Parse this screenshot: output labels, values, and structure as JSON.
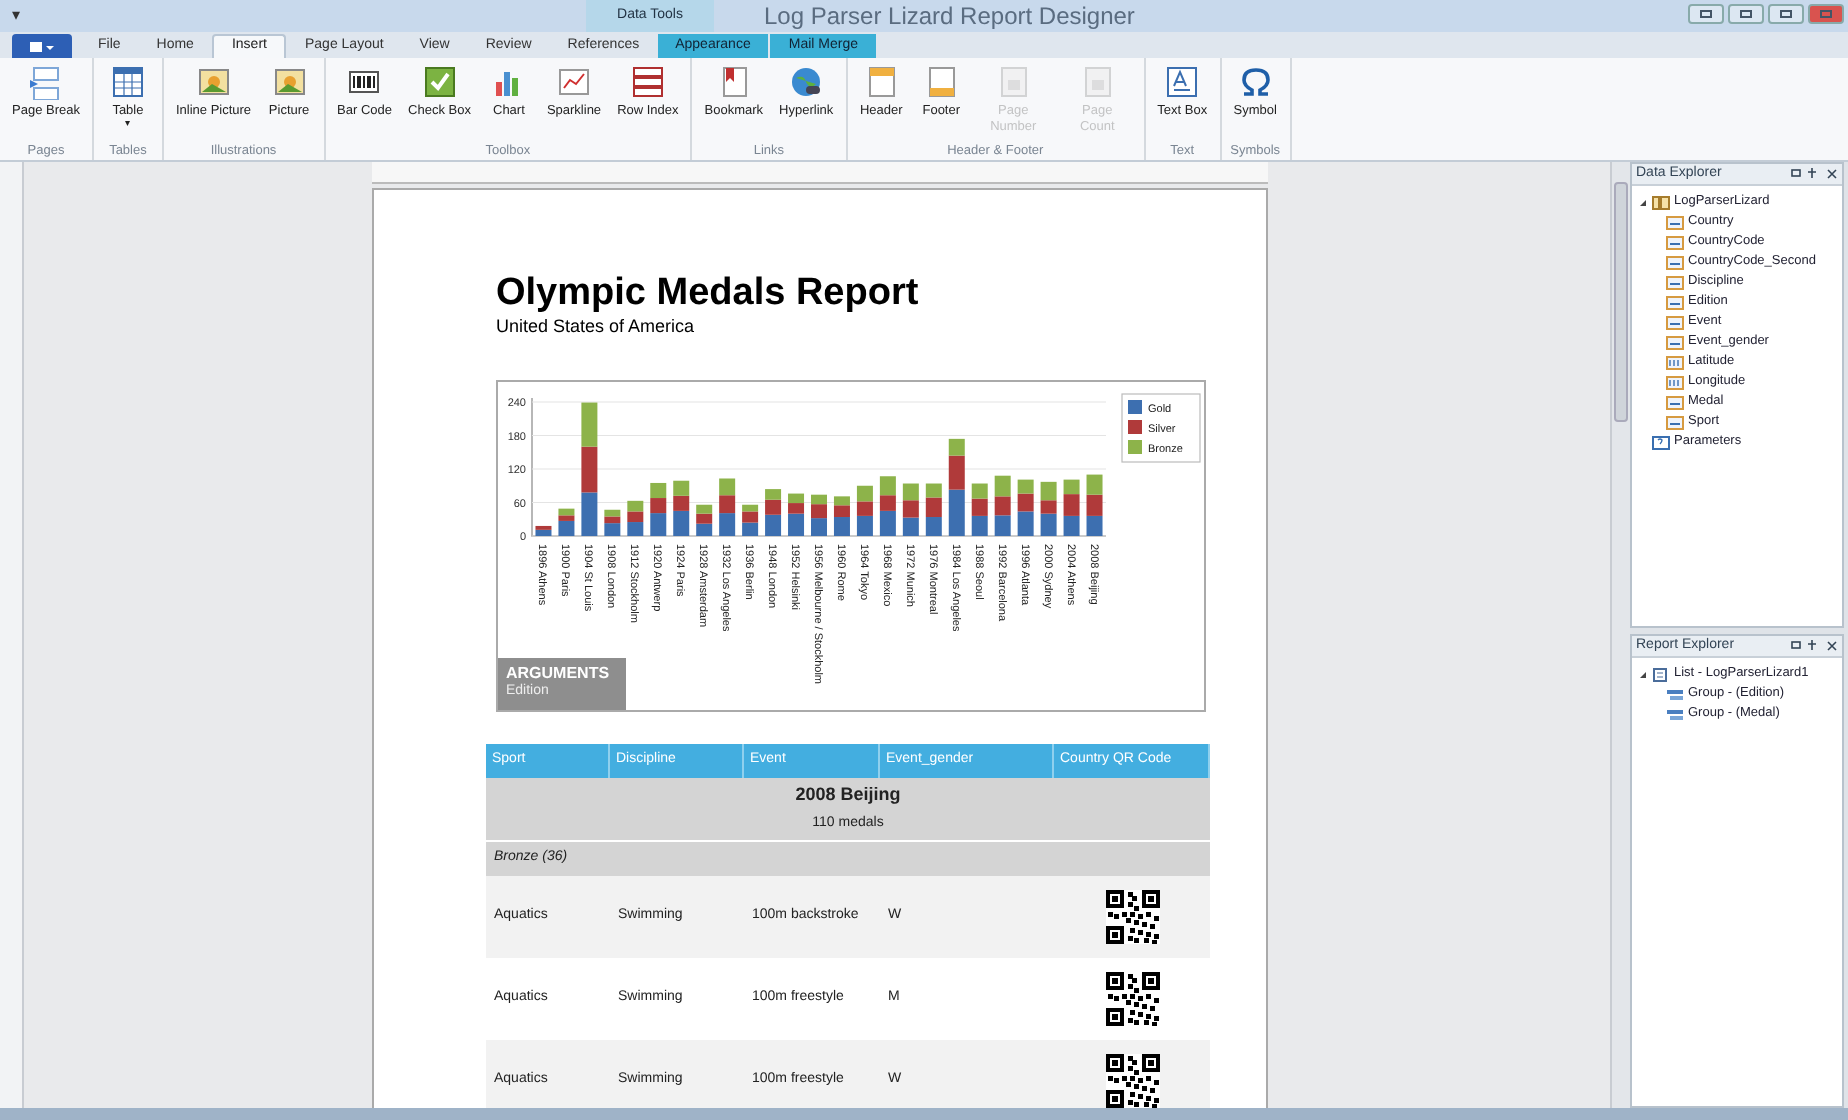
{
  "window": {
    "title": "Log Parser Lizard Report Designer",
    "quick_access": "▾",
    "contextual_group": "Data Tools"
  },
  "tabs": [
    {
      "label": "File",
      "selected": false,
      "contextual": false
    },
    {
      "label": "Home",
      "selected": false,
      "contextual": false
    },
    {
      "label": "Insert",
      "selected": true,
      "contextual": false
    },
    {
      "label": "Page Layout",
      "selected": false,
      "contextual": false
    },
    {
      "label": "View",
      "selected": false,
      "contextual": false
    },
    {
      "label": "Review",
      "selected": false,
      "contextual": false
    },
    {
      "label": "References",
      "selected": false,
      "contextual": false
    },
    {
      "label": "Appearance",
      "selected": false,
      "contextual": true
    },
    {
      "label": "Mail Merge",
      "selected": false,
      "contextual": true
    }
  ],
  "ribbon_groups": [
    {
      "label": "Pages",
      "buttons": [
        {
          "label": "Page Break",
          "disabled": false
        }
      ]
    },
    {
      "label": "Tables",
      "buttons": [
        {
          "label": "Table",
          "disabled": false,
          "caret": "▾"
        }
      ]
    },
    {
      "label": "Illustrations",
      "buttons": [
        {
          "label": "Inline Picture",
          "disabled": false
        },
        {
          "label": "Picture",
          "disabled": false
        }
      ]
    },
    {
      "label": "Toolbox",
      "buttons": [
        {
          "label": "Bar Code",
          "disabled": false
        },
        {
          "label": "Check Box",
          "disabled": false
        },
        {
          "label": "Chart",
          "disabled": false
        },
        {
          "label": "Sparkline",
          "disabled": false
        },
        {
          "label": "Row Index",
          "disabled": false
        }
      ]
    },
    {
      "label": "Links",
      "buttons": [
        {
          "label": "Bookmark",
          "disabled": false
        },
        {
          "label": "Hyperlink",
          "disabled": false
        }
      ]
    },
    {
      "label": "Header & Footer",
      "buttons": [
        {
          "label": "Header",
          "disabled": false
        },
        {
          "label": "Footer",
          "disabled": false
        },
        {
          "label": "Page Number",
          "disabled": true
        },
        {
          "label": "Page Count",
          "disabled": true
        }
      ]
    },
    {
      "label": "Text",
      "buttons": [
        {
          "label": "Text Box",
          "disabled": false
        }
      ]
    },
    {
      "label": "Symbols",
      "buttons": [
        {
          "label": "Symbol",
          "disabled": false
        }
      ]
    }
  ],
  "report": {
    "title": "Olympic Medals Report",
    "subtitle": "United States of America",
    "chart_data": {
      "type": "bar",
      "stacked": true,
      "categories": [
        "1896 Athens",
        "1900 Paris",
        "1904 St Louis",
        "1908 London",
        "1912 Stockholm",
        "1920 Antwerp",
        "1924 Paris",
        "1928 Amsterdam",
        "1932 Los Angeles",
        "1936 Berlin",
        "1948 London",
        "1952 Helsinki",
        "1956 Melbourne / Stockholm",
        "1960 Rome",
        "1964 Tokyo",
        "1968 Mexico",
        "1972 Munich",
        "1976 Montreal",
        "1984 Los Angeles",
        "1988 Seoul",
        "1992 Barcelona",
        "1996 Atlanta",
        "2000 Sydney",
        "2004 Athens",
        "2008 Beijing"
      ],
      "series": [
        {
          "name": "Gold",
          "color": "#3d6fb0",
          "values": [
            11,
            27,
            78,
            23,
            25,
            41,
            45,
            22,
            41,
            24,
            38,
            40,
            32,
            34,
            36,
            45,
            33,
            34,
            83,
            36,
            37,
            44,
            40,
            36,
            36
          ]
        },
        {
          "name": "Silver",
          "color": "#b03a3a",
          "values": [
            7,
            10,
            82,
            12,
            19,
            27,
            27,
            18,
            32,
            20,
            27,
            19,
            25,
            21,
            26,
            28,
            31,
            35,
            61,
            31,
            34,
            32,
            24,
            39,
            38
          ]
        },
        {
          "name": "Bronze",
          "color": "#8db34a",
          "values": [
            null,
            12,
            79,
            12,
            19,
            27,
            27,
            16,
            30,
            12,
            19,
            17,
            17,
            16,
            28,
            34,
            30,
            25,
            30,
            27,
            37,
            25,
            33,
            26,
            36
          ]
        }
      ],
      "ylim": [
        0,
        240
      ],
      "grid": true,
      "legend": true,
      "yticks": [
        0,
        {
          "value": 60,
          "label": "60"
        },
        120,
        180,
        240
      ]
    },
    "arguments_label": "ARGUMENTS",
    "arguments_value": "Edition",
    "table": {
      "columns": [
        "Sport",
        "Discipline",
        "Event",
        "Event_gender",
        "Country QR Code"
      ],
      "group_title": "2008 Beijing",
      "group_subtitle": "110 medals",
      "subgroup": "Bronze (36)",
      "rows": [
        [
          "Aquatics",
          "Swimming",
          "100m backstroke",
          "W"
        ],
        [
          "Aquatics",
          "Swimming",
          "100m freestyle",
          "M"
        ],
        [
          "Aquatics",
          "Swimming",
          "100m freestyle",
          "W"
        ]
      ]
    }
  },
  "data_explorer": {
    "title": "Data Explorer",
    "tree": [
      {
        "label": "LogParserLizard",
        "kind": "table",
        "expanded": true,
        "children": [
          {
            "label": "Country",
            "kind": "text"
          },
          {
            "label": "CountryCode",
            "kind": "text"
          },
          {
            "label": "CountryCode_Second",
            "kind": "text"
          },
          {
            "label": "Discipline",
            "kind": "text"
          },
          {
            "label": "Edition",
            "kind": "text"
          },
          {
            "label": "Event",
            "kind": "text"
          },
          {
            "label": "Event_gender",
            "kind": "text"
          },
          {
            "label": "Latitude",
            "kind": "number"
          },
          {
            "label": "Longitude",
            "kind": "number"
          },
          {
            "label": "Medal",
            "kind": "text"
          },
          {
            "label": "Sport",
            "kind": "text"
          }
        ]
      },
      {
        "label": "Parameters",
        "kind": "parameters"
      }
    ]
  },
  "report_explorer": {
    "title": "Report Explorer",
    "tree": [
      {
        "label": "List - LogParserLizard1",
        "kind": "list",
        "expanded": true,
        "children": [
          {
            "label": "Group - (Edition)",
            "kind": "group"
          },
          {
            "label": "Group - (Medal)",
            "kind": "group"
          }
        ]
      }
    ]
  }
}
